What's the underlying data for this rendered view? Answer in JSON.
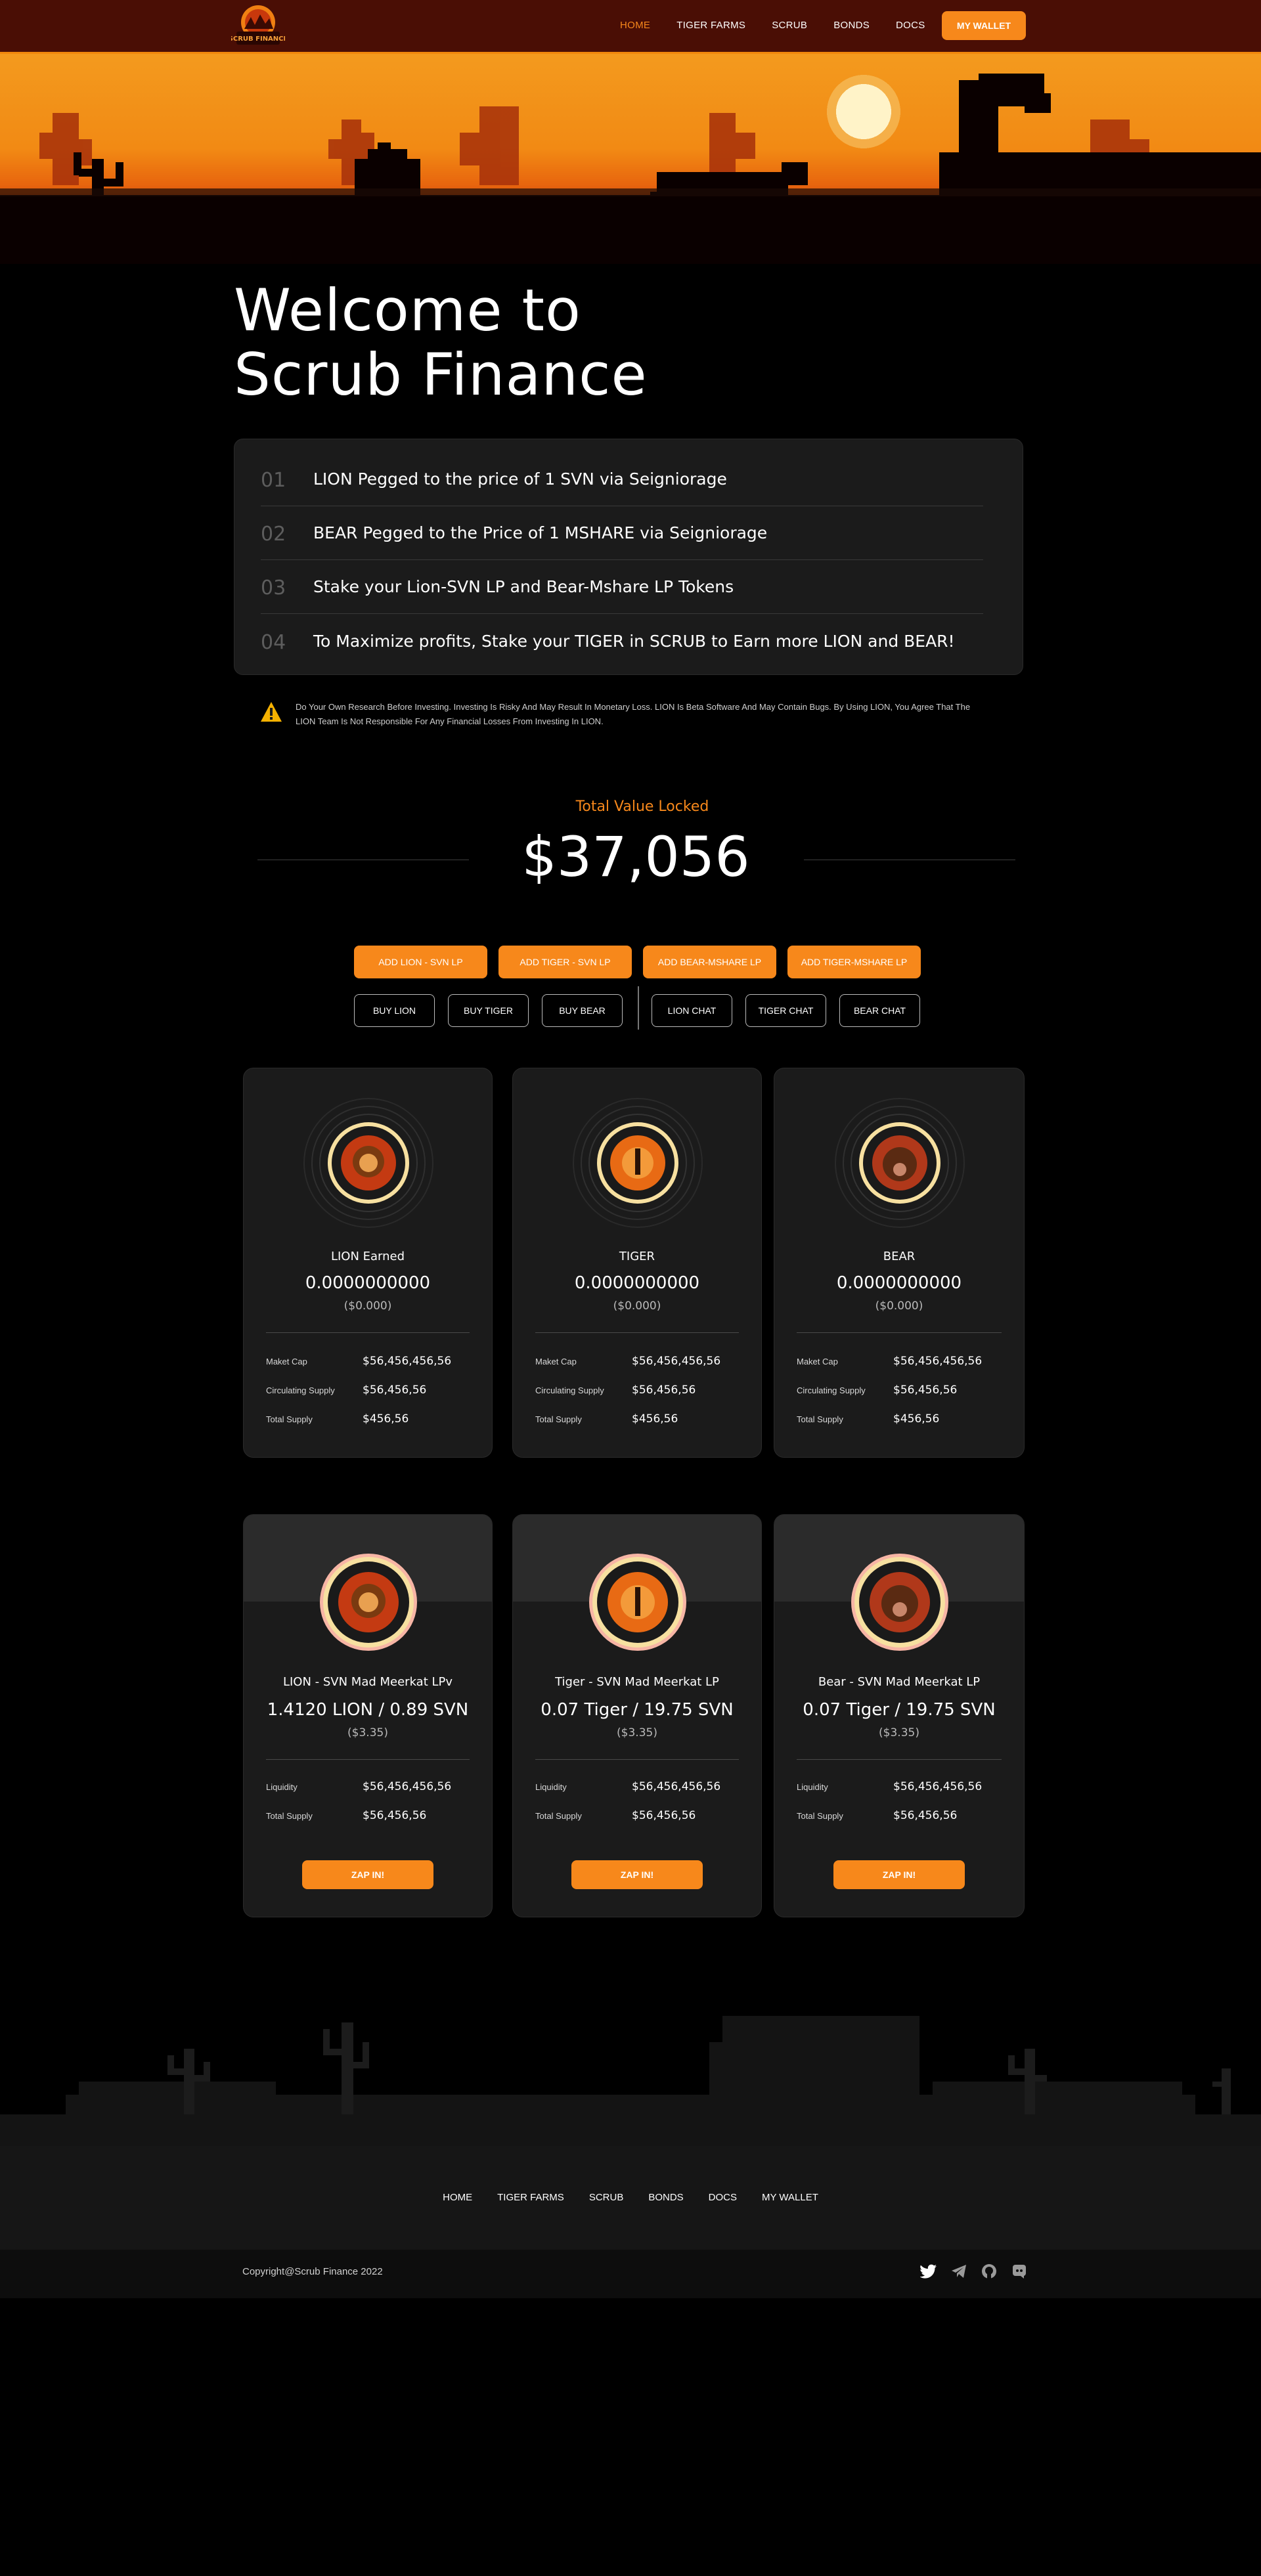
{
  "header": {
    "logo_text": "SCRUB FINANCE",
    "nav": [
      "HOME",
      "TIGER FARMS",
      "SCRUB",
      "BONDS",
      "DOCS"
    ],
    "active": "HOME",
    "wallet_label": "MY WALLET"
  },
  "hero": {
    "title_line1": "Welcome to",
    "title_line2": "Scrub Finance"
  },
  "steps": [
    {
      "num": "01",
      "text": "LION Pegged to the price of 1 SVN via Seigniorage"
    },
    {
      "num": "02",
      "text": "BEAR Pegged to the Price of 1 MSHARE via Seigniorage"
    },
    {
      "num": "03",
      "text": "Stake your Lion-SVN LP and Bear-Mshare LP Tokens"
    },
    {
      "num": "04",
      "text": "To Maximize profits, Stake your TIGER in SCRUB to Earn more LION and BEAR!"
    }
  ],
  "disclaimer": "Do Your Own Research Before Investing. Investing Is Risky And May Result In Monetary Loss. LION Is Beta Software And May Contain Bugs. By Using LION, You Agree That The LION Team Is Not Responsible For Any Financial Losses From Investing In LION.",
  "tvl": {
    "label": "Total Value Locked",
    "value": "$37,056"
  },
  "lp_buttons": [
    "ADD LION - SVN LP",
    "ADD TIGER - SVN LP",
    "ADD BEAR-MSHARE LP",
    "ADD TIGER-MSHARE LP"
  ],
  "buy_buttons": [
    "BUY LION",
    "BUY TIGER",
    "BUY BEAR"
  ],
  "chat_buttons": [
    "LION CHAT",
    "TIGER CHAT",
    "BEAR CHAT"
  ],
  "token_cards": [
    {
      "label": "LION Earned",
      "amount": "0.0000000000",
      "usd": "($0.000)",
      "stats": [
        [
          "Maket Cap",
          "$56,456,456,56"
        ],
        [
          "Circulating Supply",
          "$56,456,56"
        ],
        [
          "Total Supply",
          "$456,56"
        ]
      ]
    },
    {
      "label": "TIGER",
      "amount": "0.0000000000",
      "usd": "($0.000)",
      "stats": [
        [
          "Maket Cap",
          "$56,456,456,56"
        ],
        [
          "Circulating Supply",
          "$56,456,56"
        ],
        [
          "Total Supply",
          "$456,56"
        ]
      ]
    },
    {
      "label": "BEAR",
      "amount": "0.0000000000",
      "usd": "($0.000)",
      "stats": [
        [
          "Maket Cap",
          "$56,456,456,56"
        ],
        [
          "Circulating Supply",
          "$56,456,56"
        ],
        [
          "Total Supply",
          "$456,56"
        ]
      ]
    }
  ],
  "lp_cards": [
    {
      "label": "LION - SVN Mad Meerkat LPv",
      "amount": "1.4120 LION / 0.89 SVN",
      "usd": "($3.35)",
      "stats": [
        [
          "Liquidity",
          "$56,456,456,56"
        ],
        [
          "Total Supply",
          "$56,456,56"
        ]
      ],
      "button": "ZAP IN!"
    },
    {
      "label": "Tiger - SVN Mad Meerkat LP",
      "amount": "0.07 Tiger / 19.75 SVN",
      "usd": "($3.35)",
      "stats": [
        [
          "Liquidity",
          "$56,456,456,56"
        ],
        [
          "Total Supply",
          "$56,456,56"
        ]
      ],
      "button": "ZAP IN!"
    },
    {
      "label": "Bear - SVN Mad Meerkat LP",
      "amount": "0.07 Tiger / 19.75 SVN",
      "usd": "($3.35)",
      "stats": [
        [
          "Liquidity",
          "$56,456,456,56"
        ],
        [
          "Total Supply",
          "$56,456,56"
        ]
      ],
      "button": "ZAP IN!"
    }
  ],
  "footer": {
    "nav": [
      "HOME",
      "TIGER FARMS",
      "SCRUB",
      "BONDS",
      "DOCS",
      "MY WALLET"
    ],
    "copyright": "Copyright@Scrub Finance 2022",
    "socials": [
      "twitter-icon",
      "telegram-icon",
      "github-icon",
      "discord-icon"
    ]
  },
  "colors": {
    "accent": "#f7881b",
    "header_bg": "#4a0e05",
    "card_bg": "#1b1b1b"
  }
}
